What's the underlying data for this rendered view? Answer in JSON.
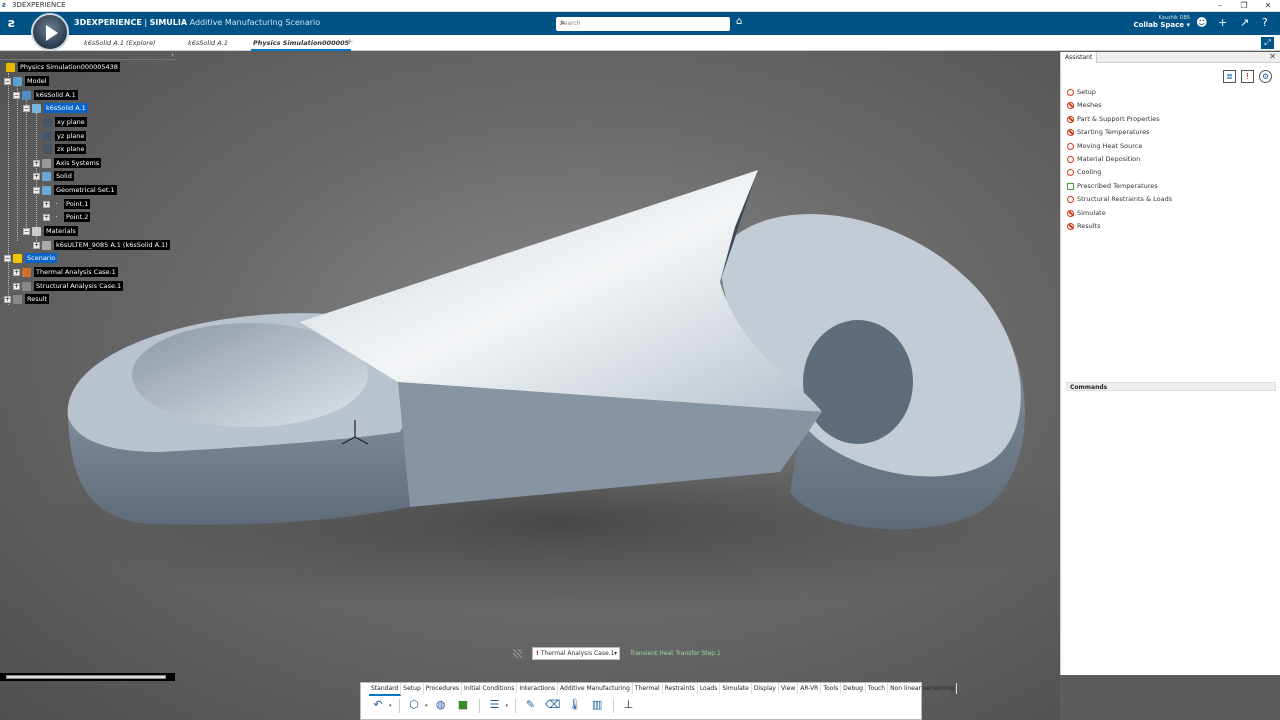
{
  "window": {
    "title": "3DEXPERIENCE",
    "controls": [
      "–",
      "❐",
      "✕"
    ]
  },
  "appbar": {
    "brand_bold": "3DEXPERIENCE",
    "brand_sep": " | ",
    "brand_product": "SIMULIA",
    "app_name": "Additive Manufacturing Scenario",
    "search_placeholder": "Search",
    "user_name": "Kaushik DBS",
    "space": "Collab Space ▾"
  },
  "tabs": [
    {
      "label": "k6sSolid A.1 (Explore)",
      "active": false
    },
    {
      "label": "k6sSolid A.1",
      "active": false
    },
    {
      "label": "Physics Simulation000005",
      "active": true
    }
  ],
  "tree": {
    "root": "Physics Simulation000005438",
    "model": "Model",
    "product": "k6sSolid A.1",
    "part": "k6sSolid A.1",
    "planes": [
      "xy plane",
      "yz plane",
      "zx plane"
    ],
    "axis_systems": "Axis Systems",
    "solid": "Solid",
    "geometrical_set": "Geometrical Set.1",
    "points": [
      "Point.1",
      "Point.2"
    ],
    "materials": "Materials",
    "material_item": "k6sULTEM_9085 A.1 (k6sSolid A.1)",
    "scenario": "Scenario",
    "thermal_case": "Thermal Analysis Case.1",
    "structural_case": "Structural Analysis Case.1",
    "result": "Result"
  },
  "assistant": {
    "tab_label": "Assistant",
    "steps": [
      {
        "label": "Setup",
        "status": "open"
      },
      {
        "label": "Meshes",
        "status": "blocked"
      },
      {
        "label": "Part & Support Properties",
        "status": "blocked"
      },
      {
        "label": "Starting Temperatures",
        "status": "blocked"
      },
      {
        "label": "Moving Heat Source",
        "status": "open"
      },
      {
        "label": "Material Deposition",
        "status": "open"
      },
      {
        "label": "Cooling",
        "status": "open"
      },
      {
        "label": "Prescribed Temperatures",
        "status": "optional"
      },
      {
        "label": "Structural Restraints & Loads",
        "status": "open"
      },
      {
        "label": "Simulate",
        "status": "blocked"
      },
      {
        "label": "Results",
        "status": "blocked"
      }
    ],
    "commands_label": "Commands"
  },
  "viewport": {
    "analysis_case": "Thermal Analysis Case.1",
    "analysis_mark": "!",
    "step_label": "Transient Heat Transfer Step.1"
  },
  "toolbar": {
    "tabs": [
      "Standard",
      "Setup",
      "Procedures",
      "Initial Conditions",
      "Interactions",
      "Additive Manufacturing",
      "Thermal",
      "Restraints",
      "Loads",
      "Simulate",
      "Display",
      "View",
      "AR-VR",
      "Tools",
      "Debug",
      "Touch",
      "Non linear versioning"
    ],
    "active_tab": "Standard"
  },
  "colors": {
    "appbar": "#005386",
    "accent": "#0078c8",
    "selection": "#0a64c8",
    "warning": "#d23a14"
  }
}
